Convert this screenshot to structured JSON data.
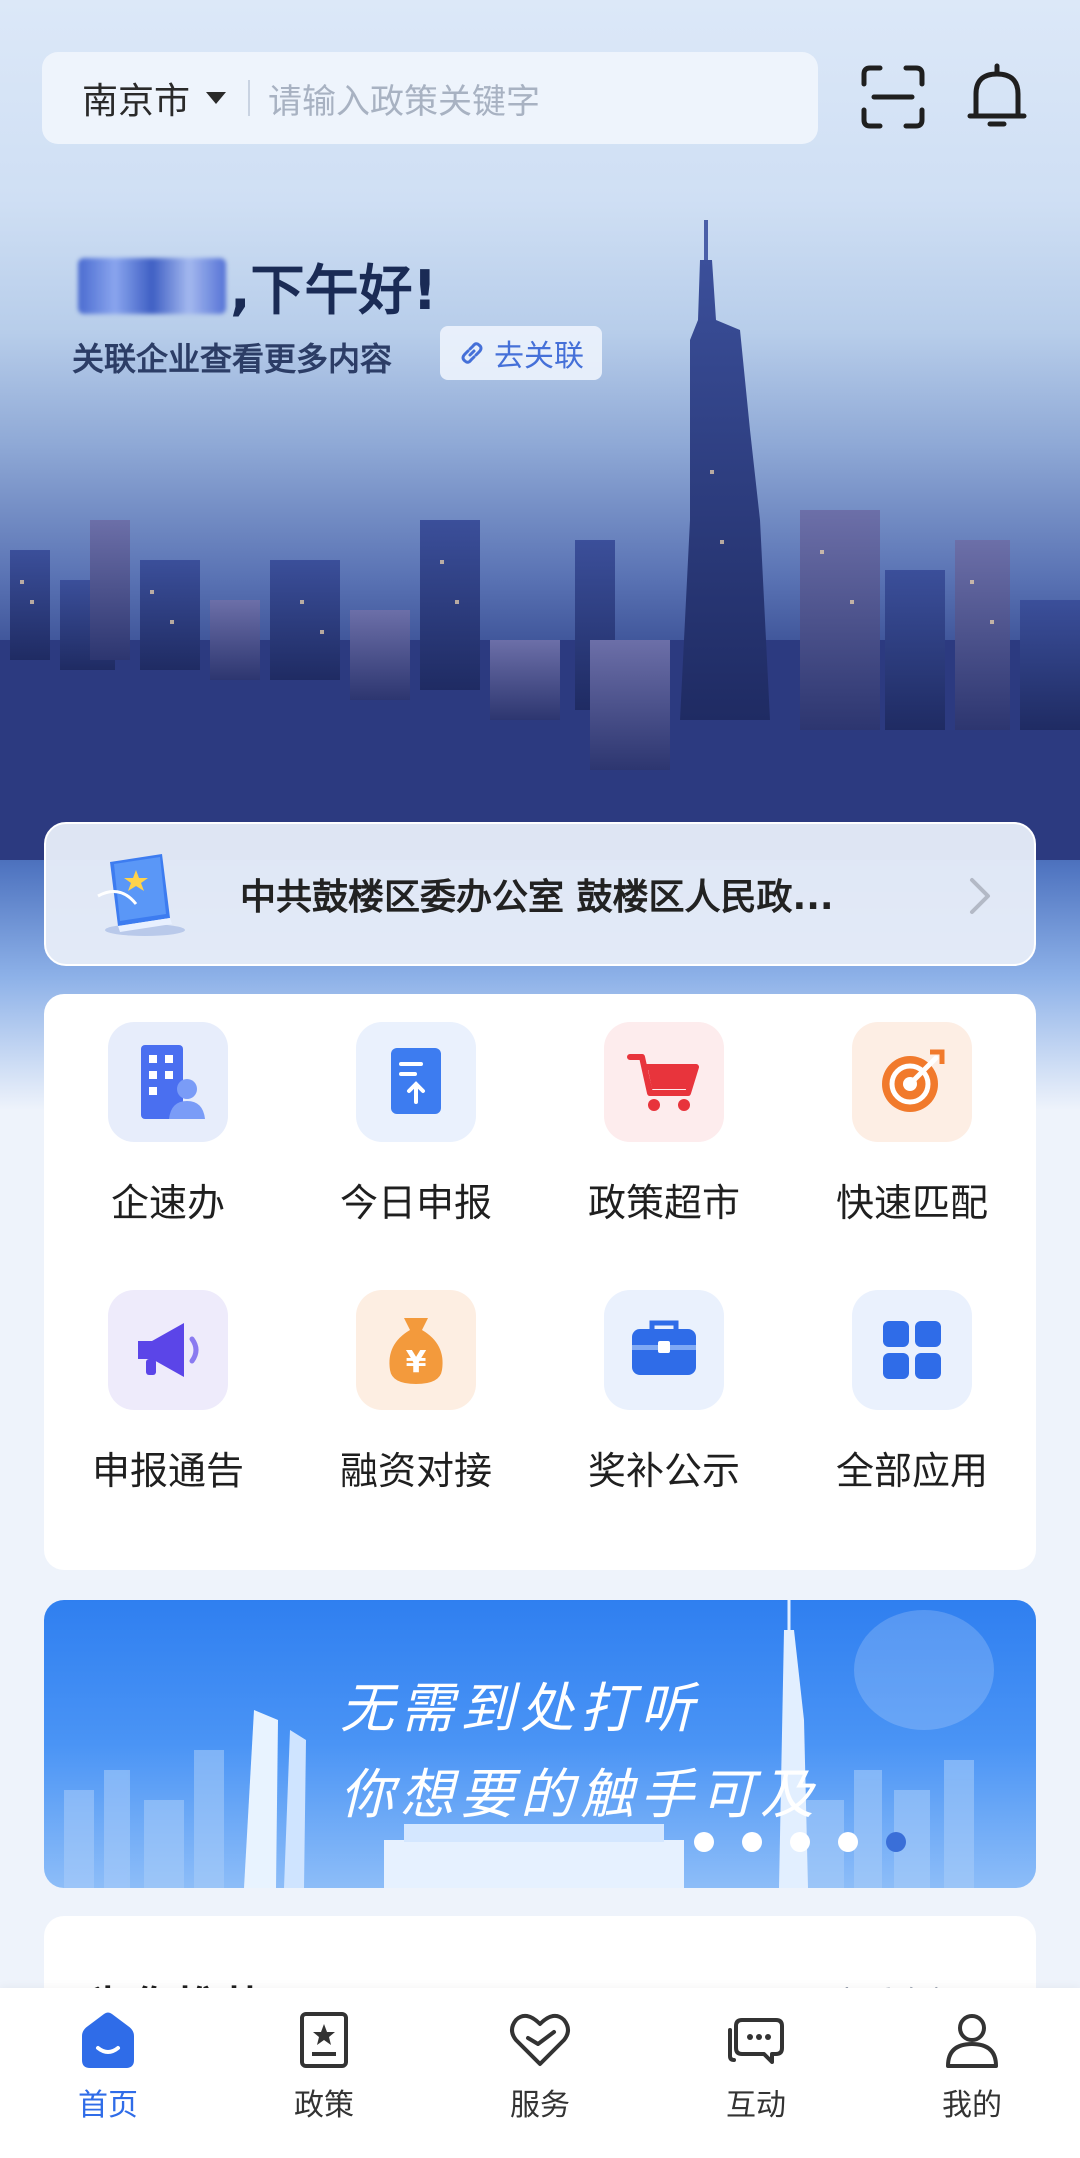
{
  "header": {
    "city": "南京市",
    "search_placeholder": "请输入政策关键字",
    "greeting_suffix": ",下午好!",
    "subtitle": "关联企业查看更多内容",
    "link_button": "去关联"
  },
  "notice": {
    "text": "中共鼓楼区委办公室 鼓楼区人民政..."
  },
  "grid": [
    {
      "label": "企速办",
      "icon": "building-person-icon"
    },
    {
      "label": "今日申报",
      "icon": "document-upload-icon"
    },
    {
      "label": "政策超市",
      "icon": "shopping-cart-icon"
    },
    {
      "label": "快速匹配",
      "icon": "target-icon"
    },
    {
      "label": "申报通告",
      "icon": "megaphone-icon"
    },
    {
      "label": "融资对接",
      "icon": "money-bag-icon"
    },
    {
      "label": "奖补公示",
      "icon": "briefcase-icon"
    },
    {
      "label": "全部应用",
      "icon": "grid-apps-icon"
    }
  ],
  "banner": {
    "line1": "无需到处打听",
    "line2": "你想要的触手可及",
    "dot_count": 5,
    "active_dot": 5
  },
  "recommend": {
    "title": "为你推荐",
    "more": "查看全部 >"
  },
  "tabs": [
    {
      "label": "首页",
      "active": true
    },
    {
      "label": "政策",
      "active": false
    },
    {
      "label": "服务",
      "active": false
    },
    {
      "label": "互动",
      "active": false
    },
    {
      "label": "我的",
      "active": false
    }
  ],
  "colors": {
    "accent": "#2f6ce8"
  }
}
